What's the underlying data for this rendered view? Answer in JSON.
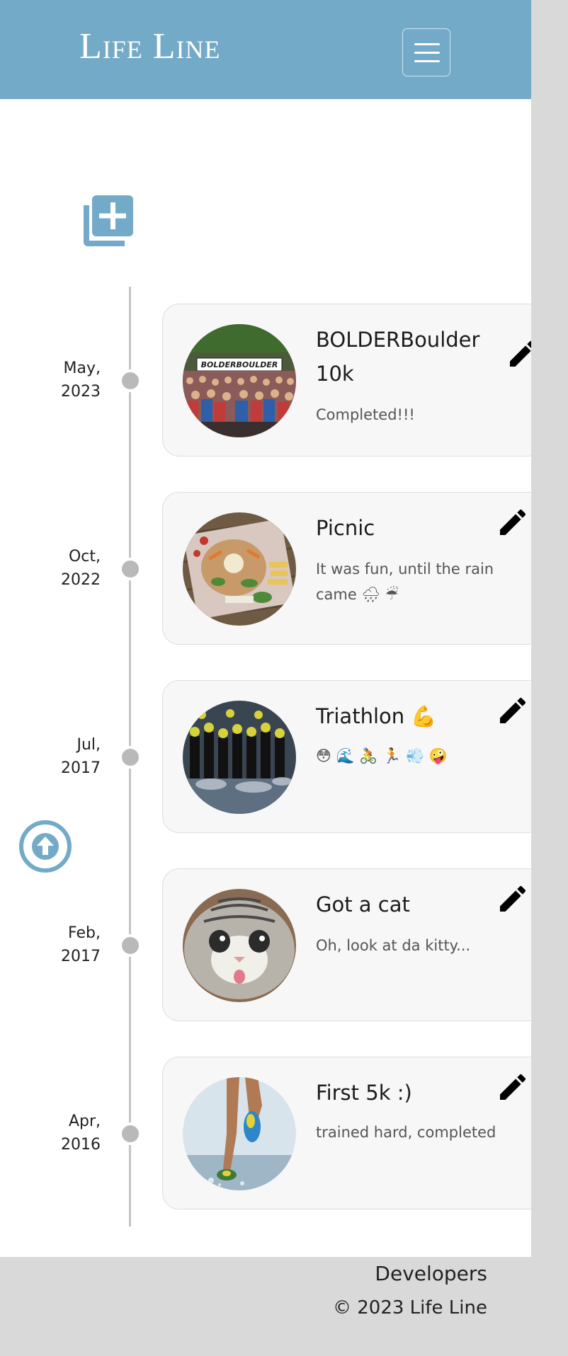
{
  "header": {
    "brand_first": "Life",
    "brand_second": "Line",
    "menu_icon": "hamburger-icon",
    "bg_color": "#72aac7"
  },
  "actions": {
    "add_icon": "add-to-collection-icon",
    "scroll_top_icon": "arrow-up-circle-icon"
  },
  "timeline": {
    "entries": [
      {
        "month": "May,",
        "year": "2023",
        "title": "BOLDERBoulder 10k",
        "description": "Completed!!!",
        "image": "crowd-race-photo",
        "edit_icon": "pencil-icon"
      },
      {
        "month": "Oct,",
        "year": "2022",
        "title": "Picnic",
        "description": "It was fun, until the rain came 🌧 ☔",
        "image": "picnic-food-photo",
        "edit_icon": "pencil-icon"
      },
      {
        "month": "Jul,",
        "year": "2017",
        "title": "Triathlon 💪",
        "description": "😳 🌊 🚴 🏃 💨 🤪",
        "image": "triathlon-swimmers-photo",
        "edit_icon": "pencil-icon"
      },
      {
        "month": "Feb,",
        "year": "2017",
        "title": "Got a cat",
        "description": "Oh, look at da kitty...",
        "image": "kitten-photo",
        "edit_icon": "pencil-icon"
      },
      {
        "month": "Apr,",
        "year": "2016",
        "title": "First 5k :)",
        "description": "trained hard, completed",
        "image": "runner-legs-photo",
        "edit_icon": "pencil-icon"
      }
    ]
  },
  "footer": {
    "link": "Developers",
    "copyright": "© 2023 Life Line"
  }
}
